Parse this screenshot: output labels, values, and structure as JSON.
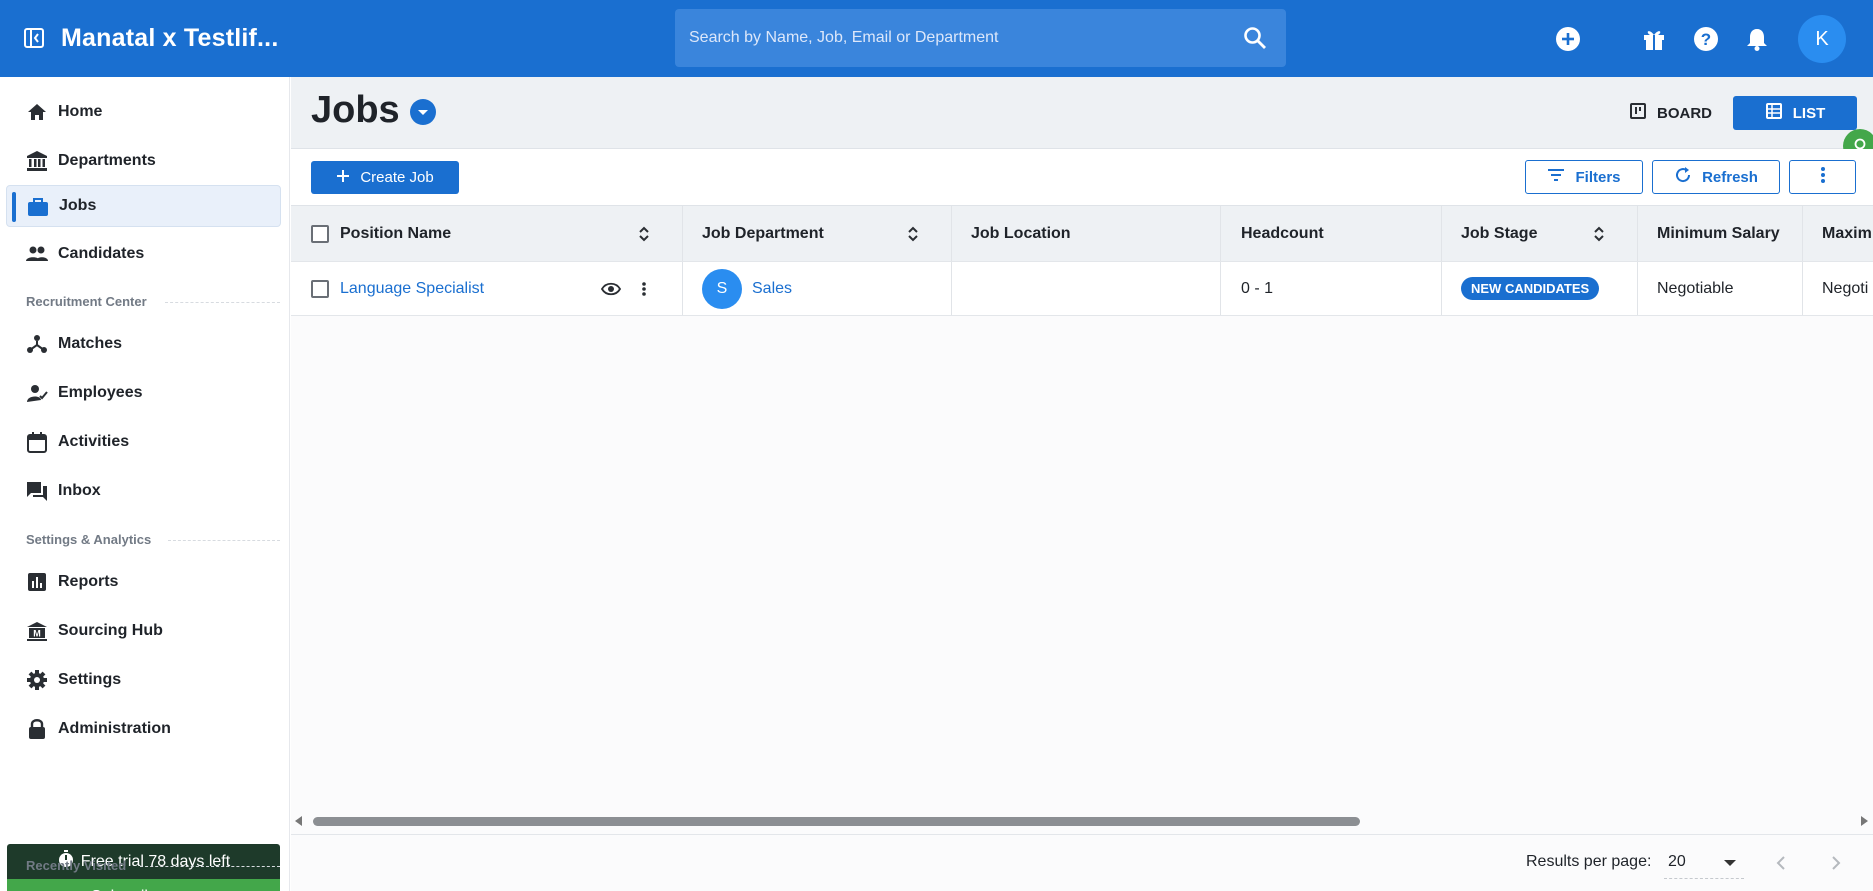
{
  "app": {
    "title": "Manatal x Testlif...",
    "search_placeholder": "Search by Name, Job, Email or Department",
    "user_initial": "K",
    "brand_color": "#1a6fd0"
  },
  "topbar_icons": [
    "add-circle-icon",
    "gift-icon",
    "help-icon",
    "bell-icon"
  ],
  "sidebar": {
    "items": [
      {
        "label": "Home",
        "icon": "home-icon"
      },
      {
        "label": "Departments",
        "icon": "bank-icon"
      },
      {
        "label": "Jobs",
        "icon": "briefcase-icon",
        "active": true
      },
      {
        "label": "Candidates",
        "icon": "people-icon"
      },
      {
        "label": "Matches",
        "icon": "matches-icon"
      },
      {
        "label": "Employees",
        "icon": "employee-icon"
      },
      {
        "label": "Activities",
        "icon": "calendar-icon"
      },
      {
        "label": "Inbox",
        "icon": "inbox-icon"
      },
      {
        "label": "Reports",
        "icon": "reports-icon"
      },
      {
        "label": "Sourcing Hub",
        "icon": "sourcing-hub-icon"
      },
      {
        "label": "Settings",
        "icon": "gear-icon"
      },
      {
        "label": "Administration",
        "icon": "lock-icon"
      }
    ],
    "sections": [
      "Recruitment Center",
      "Settings & Analytics",
      "Recently Visited"
    ],
    "trial_text": "Free trial 78 days left",
    "subscribe_label": "Subscribe now"
  },
  "page": {
    "title": "Jobs",
    "board_label": "BOARD",
    "list_label": "LIST",
    "create_label": "Create Job",
    "filters_label": "Filters",
    "refresh_label": "Refresh"
  },
  "table": {
    "columns": [
      "Position Name",
      "Job Department",
      "Job Location",
      "Headcount",
      "Job Stage",
      "Minimum Salary",
      "Maxim"
    ],
    "rows": [
      {
        "position": "Language Specialist",
        "department_initial": "S",
        "department": "Sales",
        "location": "",
        "headcount": "0 - 1",
        "stage": "NEW CANDIDATES",
        "min_salary": "Negotiable",
        "max_salary": "Negoti"
      }
    ]
  },
  "footer": {
    "results_label": "Results per page:",
    "results_value": "20"
  }
}
